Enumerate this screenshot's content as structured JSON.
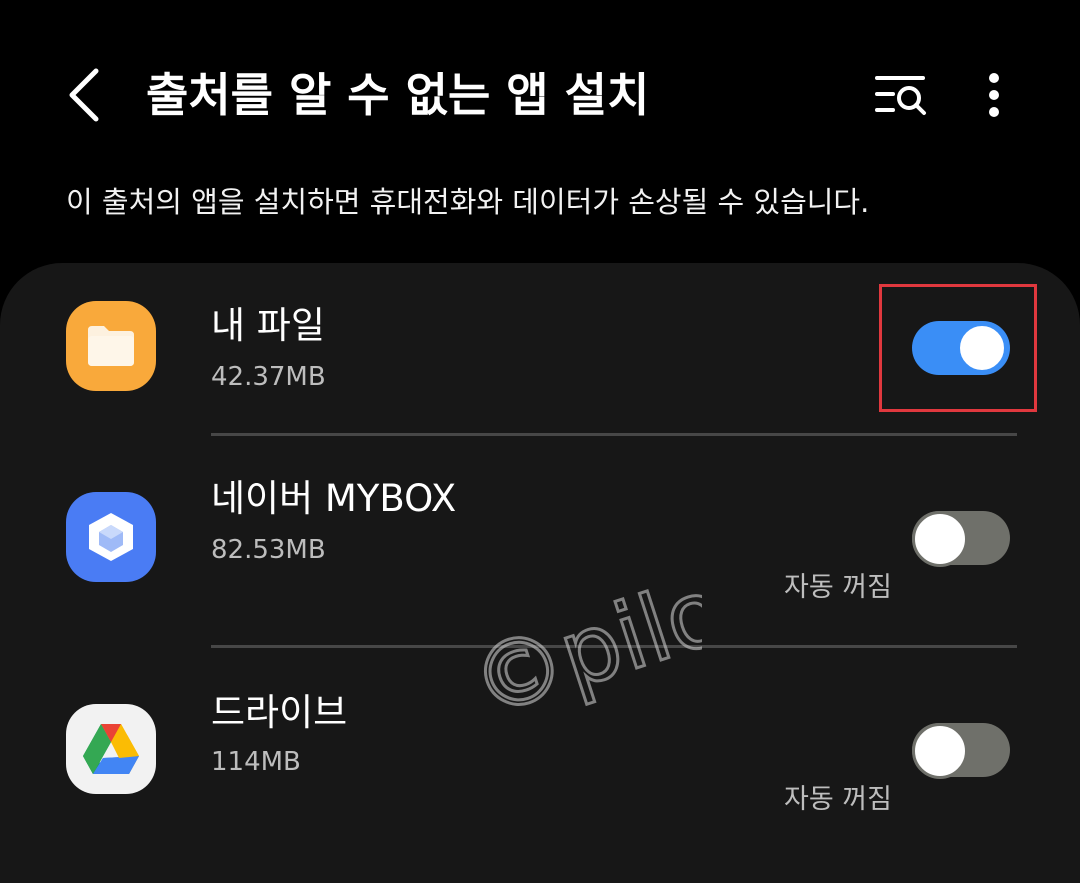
{
  "header": {
    "title": "출처를 알 수 없는 앱 설치",
    "back_icon": "chevron-left-icon",
    "search_icon": "list-search-icon",
    "more_icon": "more-vertical-icon"
  },
  "warning_text": "이 출처의 앱을 설치하면 휴대전화와 데이터가 손상될 수 있습니다.",
  "apps": [
    {
      "name": "내 파일",
      "size": "42.37MB",
      "icon": "my-files-folder-icon",
      "icon_color": "#f9a93b",
      "allowed": true,
      "auto_off_label": ""
    },
    {
      "name": "네이버 MYBOX",
      "size": "82.53MB",
      "icon": "mybox-cube-icon",
      "icon_color": "#4a7cf4",
      "allowed": false,
      "auto_off_label": "자동 꺼짐"
    },
    {
      "name": "드라이브",
      "size": "114MB",
      "icon": "google-drive-icon",
      "icon_color": "#f2f2f2",
      "allowed": false,
      "auto_off_label": "자동 꺼짐"
    }
  ],
  "colors": {
    "background": "#000000",
    "card": "#171717",
    "toggle_on": "#3a8ef6",
    "toggle_off": "#6f706a",
    "highlight": "#e0383e"
  },
  "watermark": "©pilo"
}
